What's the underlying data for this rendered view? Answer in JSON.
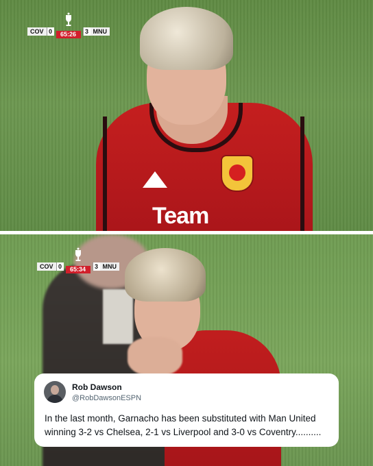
{
  "scoreboard_top": {
    "home": "COV",
    "home_score": "0",
    "clock": "65:26",
    "away_score": "3",
    "away": "MNU"
  },
  "scoreboard_bottom": {
    "home": "COV",
    "home_score": "0",
    "clock": "65:34",
    "away_score": "3",
    "away": "MNU"
  },
  "jersey": {
    "sponsor": "Team"
  },
  "tweet": {
    "author_name": "Rob Dawson",
    "author_handle": "@RobDawsonESPN",
    "text": "In the last month, Garnacho has been substituted with Man United winning 3-2 vs Chelsea, 2-1 vs Liverpool and 3-0 vs Coventry.........."
  },
  "colors": {
    "clock_bg": "#d11f2b",
    "jersey_red": "#c51f1f",
    "pitch_green": "#6c9750"
  }
}
